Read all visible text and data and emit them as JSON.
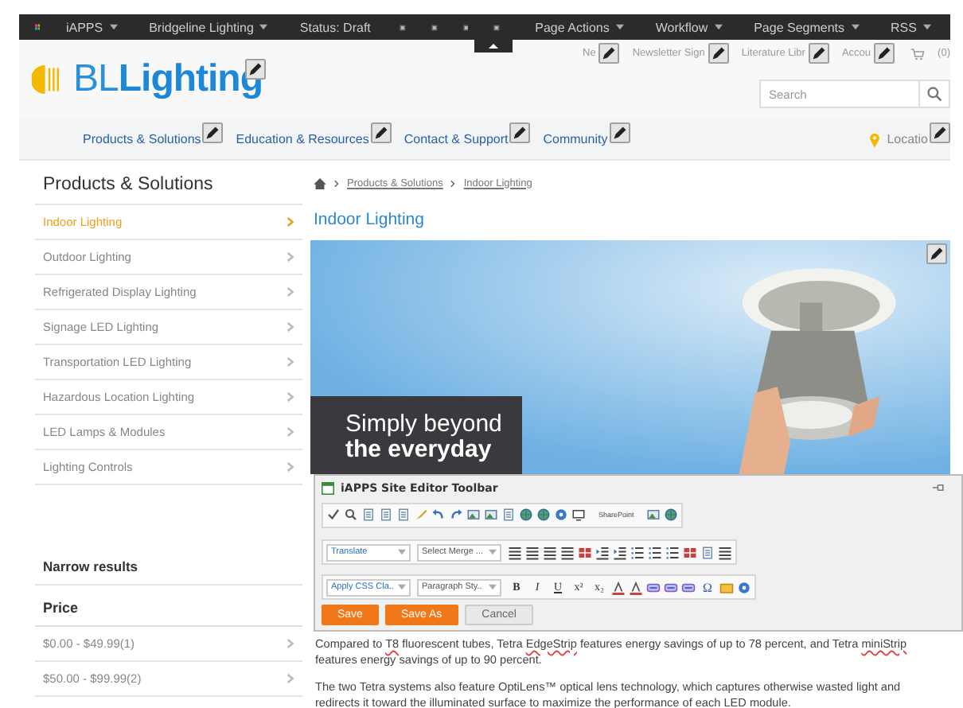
{
  "admin_bar": {
    "menus": [
      {
        "label": "iAPPS",
        "dropdown": true
      },
      {
        "label": "Bridgeline Lighting",
        "dropdown": true
      },
      {
        "label": "Status: Draft",
        "dropdown": false
      }
    ],
    "right_menus": [
      {
        "label": "Page Actions",
        "dropdown": true
      },
      {
        "label": "Workflow",
        "dropdown": true
      },
      {
        "label": "Page Segments",
        "dropdown": true
      },
      {
        "label": "RSS",
        "dropdown": true
      }
    ]
  },
  "header": {
    "utility_links": [
      "Ne",
      "Newsletter Sign",
      "Literature Libr",
      "Accou"
    ],
    "cart_count": "(0)",
    "logo": "BL**Lighting**",
    "search": {
      "placeholder": "Search"
    }
  },
  "nav": {
    "items": [
      "Products & Solutions",
      "Education & Resources",
      "Contact & Support",
      "Community"
    ],
    "location": "Locatio"
  },
  "sidebar": {
    "title": "Products & Solutions",
    "items": [
      {
        "label": "Indoor Lighting",
        "selected": true
      },
      {
        "label": "Outdoor Lighting",
        "selected": false
      },
      {
        "label": "Refrigerated Display Lighting",
        "selected": false
      },
      {
        "label": "Signage LED Lighting",
        "selected": false
      },
      {
        "label": "Transportation LED Lighting",
        "selected": false
      },
      {
        "label": "Hazardous Location Lighting",
        "selected": false
      },
      {
        "label": "LED Lamps & Modules",
        "selected": false
      },
      {
        "label": "Lighting Controls",
        "selected": false
      }
    ],
    "narrow_title": "Narrow results",
    "facet": "Price",
    "options": [
      "$0.00 - $49.99(1)",
      "$50.00 - $99.99(2)"
    ]
  },
  "main": {
    "breadcrumb": [
      "Products & Solutions",
      "Indoor Lighting"
    ],
    "heading": "Indoor Lighting",
    "banner": {
      "kind": "picture",
      "headline": [
        "Simply beyond",
        "the everyday"
      ]
    }
  },
  "editor": {
    "title": "iAPPS Site Editor Toolbar",
    "sharepoint": "SharePoint",
    "selects": [
      "Translate",
      "Select Merge ...",
      "Apply CSS Cla..",
      "Paragraph Sty.."
    ],
    "format_keys": [
      "B",
      "I",
      "U",
      "x²",
      "x₂"
    ],
    "symbol_key": "Ω",
    "buttons": [
      {
        "label": "Save",
        "kind": "primary"
      },
      {
        "label": "Save As",
        "kind": "primary"
      },
      {
        "label": "Cancel",
        "kind": "secondary"
      }
    ],
    "paragraphs": [
      [
        {
          "text": "Compared to ",
          "flagged": false
        },
        {
          "text": "T8",
          "flagged": true
        },
        {
          "text": " fluorescent tubes, Tetra ",
          "flagged": false
        },
        {
          "text": "EdgeStrip",
          "flagged": true
        },
        {
          "text": " features energy savings of up to 78 percent, and Tetra ",
          "flagged": false
        },
        {
          "text": "miniStrip",
          "flagged": true
        },
        {
          "text": " features energy savings of up to 90 percent.",
          "flagged": false
        }
      ],
      [
        {
          "text": "The two Tetra systems also feature OptiLens™ optical lens technology, which captures otherwise wasted light and redirects it toward the illuminated surface to maximize the performance of each LED module.",
          "flagged": false
        }
      ]
    ]
  }
}
